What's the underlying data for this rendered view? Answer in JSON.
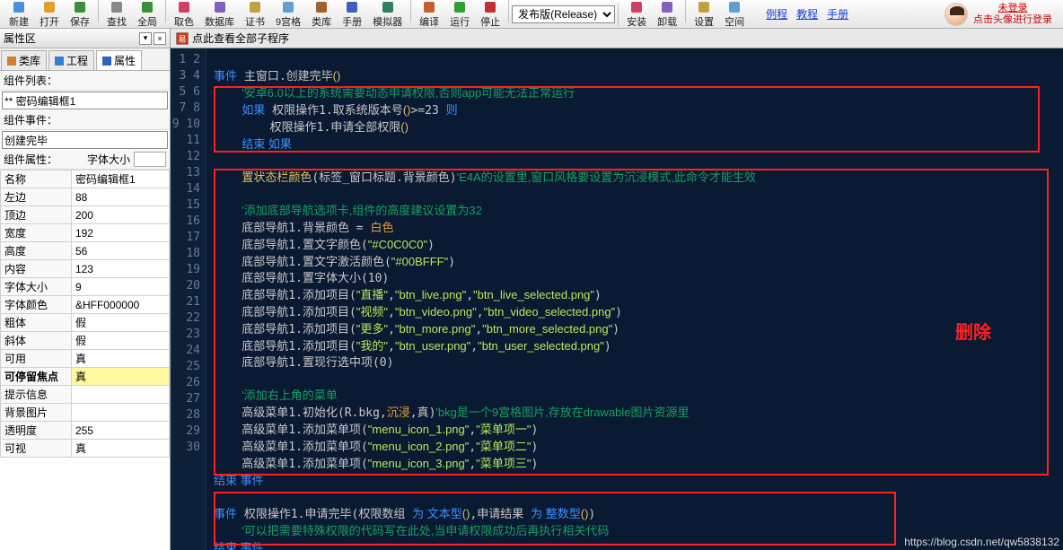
{
  "toolbar": {
    "buttons": [
      "新建",
      "打开",
      "保存",
      "查找",
      "全局",
      "取色",
      "数据库",
      "证书",
      "9宫格",
      "类库",
      "手册",
      "模拟器",
      "编译",
      "运行",
      "停止"
    ],
    "combo_value": "发布版(Release)",
    "buttons2": [
      "安装",
      "卸载",
      "设置",
      "空间"
    ],
    "links": [
      "例程",
      "教程",
      "手册"
    ],
    "not_logged": "未登录",
    "login_tip": "点击头像进行登录"
  },
  "left": {
    "panel_title": "属性区",
    "tabs": [
      "类库",
      "工程",
      "属性"
    ],
    "active_tab": 2,
    "list_label": "组件列表：",
    "combo1": "** 密码编辑框1",
    "evt_label": "组件事件：",
    "combo2": "创建完毕",
    "prop_label": "组件属性：",
    "font_label": "字体大小",
    "props": [
      [
        "名称",
        "密码编辑框1"
      ],
      [
        "左边",
        "88"
      ],
      [
        "顶边",
        "200"
      ],
      [
        "宽度",
        "192"
      ],
      [
        "高度",
        "56"
      ],
      [
        "内容",
        "123"
      ],
      [
        "字体大小",
        "9"
      ],
      [
        "字体颜色",
        "&HFF000000"
      ],
      [
        "粗体",
        "假"
      ],
      [
        "斜体",
        "假"
      ],
      [
        "可用",
        "真"
      ],
      [
        "可停留焦点",
        "真",
        "hl bold"
      ],
      [
        "提示信息",
        ""
      ],
      [
        "背景图片",
        ""
      ],
      [
        "透明度",
        "255"
      ],
      [
        "可视",
        "真"
      ]
    ]
  },
  "editor": {
    "doc_tab": "点此查看全部子程序",
    "lines": [
      "",
      "<kw>事件</kw> 主窗口.创建完毕<fn>()</fn>",
      "    <cmt>'安卓6.0以上的系统需要动态申请权限,否则app可能无法正常运行</cmt>",
      "    <kw>如果</kw> 权限操作1.取系统版本号<fn>()</fn>>=23 <kw>则</kw>",
      "        权限操作1.申请全部权限<fn>()</fn>",
      "    <kw>结束 如果</kw>",
      "",
      "    <fn>置状态栏颜色</fn>(标签_窗口标题.背景颜色)<cmt>'E4A的设置里,窗口风格要设置为沉浸模式,此命令才能生效</cmt>",
      "",
      "    <cmt>'添加底部导航选项卡,组件的高度建议设置为32</cmt>",
      "    底部导航1.背景颜色 = <num>白色</num>",
      "    底部导航1.置文字颜色(<str>\"#C0C0C0\"</str>)",
      "    底部导航1.置文字激活颜色(<str>\"#00BFFF\"</str>)",
      "    底部导航1.置字体大小(10)",
      "    底部导航1.添加项目(<str>\"直播\"</str>,<str>\"btn_live.png\"</str>,<str>\"btn_live_selected.png\"</str>)",
      "    底部导航1.添加项目(<str>\"视频\"</str>,<str>\"btn_video.png\"</str>,<str>\"btn_video_selected.png\"</str>)",
      "    底部导航1.添加项目(<str>\"更多\"</str>,<str>\"btn_more.png\"</str>,<str>\"btn_more_selected.png\"</str>)",
      "    底部导航1.添加项目(<str>\"我的\"</str>,<str>\"btn_user.png\"</str>,<str>\"btn_user_selected.png\"</str>)",
      "    底部导航1.置现行选中项(0)",
      "",
      "    <cmt>'添加右上角的菜单</cmt>",
      "    高级菜单1.初始化(R.bkg,<num>沉浸</num>,真)<cmt>'bkg是一个9宫格图片,存放在drawable图片资源里</cmt>",
      "    高级菜单1.添加菜单项(<str>\"menu_icon_1.png\"</str>,<str>\"菜单项一\"</str>)",
      "    高级菜单1.添加菜单项(<str>\"menu_icon_2.png\"</str>,<str>\"菜单项二\"</str>)",
      "    高级菜单1.添加菜单项(<str>\"menu_icon_3.png\"</str>,<str>\"菜单项三\"</str>)",
      "<kw>结束 事件</kw>",
      "",
      "<kw>事件</kw> 权限操作1.申请完毕(权限数组 <kw>为 文本型</kw><fn>()</fn>,申请结果 <kw>为 整数型</kw><fn>()</fn>)",
      "    <cmt>'可以把需要特殊权限的代码写在此处,当申请权限成功后再执行相关代码</cmt>",
      "<kw>结束 事件</kw>"
    ],
    "delete_label": "删除",
    "watermark": "https://blog.csdn.net/qw5838132"
  }
}
